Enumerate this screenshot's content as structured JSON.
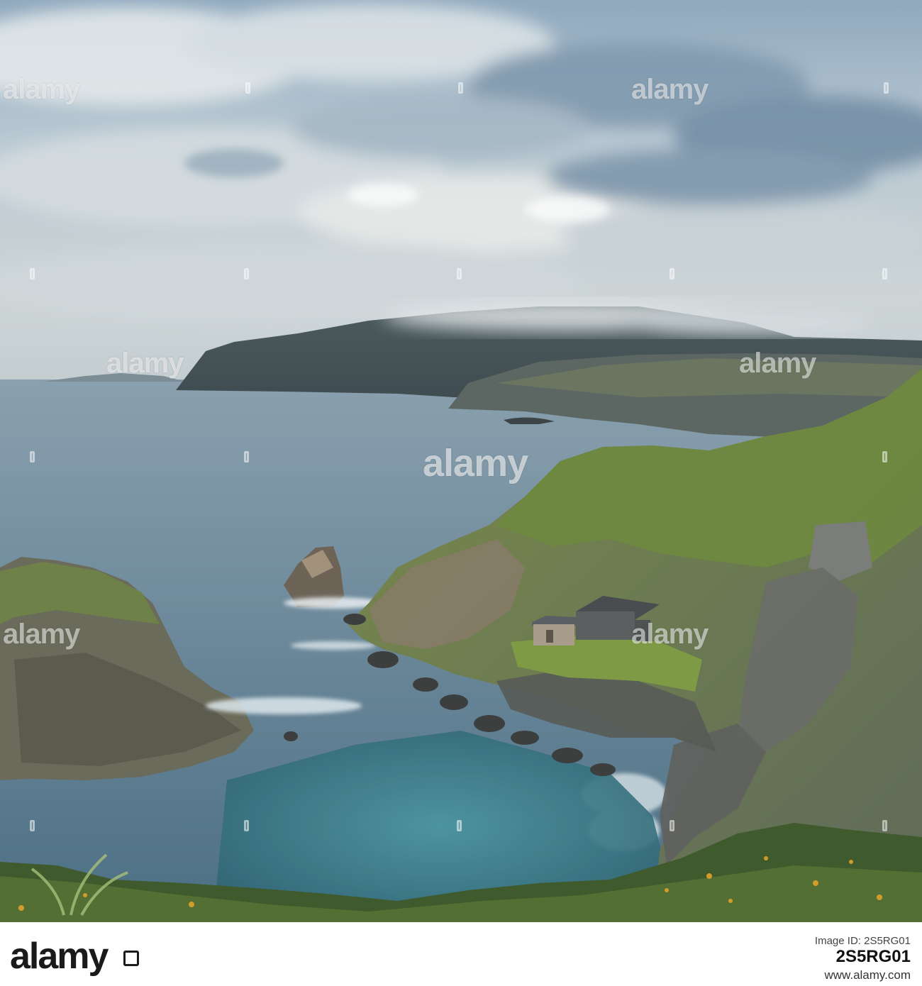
{
  "image": {
    "alt": "Coastal cliffs with small stone huts above a rocky cove under a cloudy sky"
  },
  "watermark": {
    "text": "alamy",
    "color": "#ffffff"
  },
  "footer": {
    "logo_text": "alamy",
    "image_id_label": "Image ID: 2S5RG01",
    "image_id": "2S5RG01",
    "url": "www.alamy.com"
  },
  "colors": {
    "sky": "#a9bccb",
    "sea": "#5d7e92",
    "cove": "#3f7f8c",
    "grass": "#6f8a3e",
    "rock": "#6b6a64"
  }
}
